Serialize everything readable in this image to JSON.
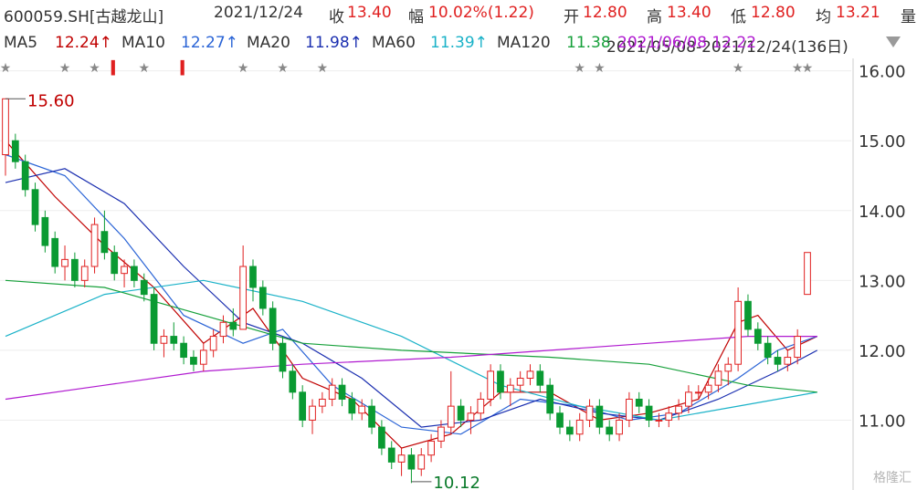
{
  "header": {
    "code": "600059.SH[古越龙山]",
    "date": "2021/12/24",
    "close_label": "收",
    "close_value": "13.40",
    "change_label": "幅",
    "change_value": "10.02%(1.22)",
    "open_label": "开",
    "open_value": "12.80",
    "high_label": "高",
    "high_value": "13.40",
    "low_label": "低",
    "low_value": "12.80",
    "avg_label": "均",
    "avg_value": "13.21",
    "volume_label": "量"
  },
  "ma_row": {
    "ma5_label": "MA5",
    "ma5_value": "12.24↑",
    "ma10_label": "MA10",
    "ma10_value": "12.27↑",
    "ma20_label": "MA20",
    "ma20_value": "11.98↑",
    "ma60_label": "MA60",
    "ma60_value": "11.39↑",
    "ma120_label": "MA120",
    "ma120_value": "11.38",
    "range_text": "2021/05/08-2021/12/24(136日)",
    "overlay_text": "2021/06/08 12.22",
    "dropdown_icon": "triangle-down-icon"
  },
  "annotations": {
    "high": "15.60",
    "low": "10.12"
  },
  "watermark": "格隆汇",
  "colors": {
    "up": "#e02020",
    "down": "#0a9a32",
    "ma5": "#c00000",
    "ma10": "#2a64d6",
    "ma20": "#1b2fb0",
    "ma60": "#1ab2c8",
    "ma120": "#16a03a",
    "ma250": "#b01ad0",
    "marker": "#888888"
  },
  "chart_data": {
    "type": "candlestick",
    "ylim": [
      10.0,
      16.1
    ],
    "yticks": [
      "16.00",
      "15.00",
      "14.00",
      "13.00",
      "12.00",
      "11.00"
    ],
    "candles": [
      [
        14.8,
        15.6,
        14.5,
        15.6
      ],
      [
        15.0,
        15.1,
        14.6,
        14.7
      ],
      [
        14.7,
        14.8,
        14.2,
        14.3
      ],
      [
        14.3,
        14.4,
        13.7,
        13.8
      ],
      [
        13.9,
        14.0,
        13.4,
        13.5
      ],
      [
        13.6,
        13.7,
        13.1,
        13.2
      ],
      [
        13.2,
        13.5,
        13.0,
        13.3
      ],
      [
        13.3,
        13.4,
        12.9,
        13.0
      ],
      [
        13.0,
        13.3,
        12.9,
        13.2
      ],
      [
        13.2,
        13.9,
        13.1,
        13.8
      ],
      [
        13.7,
        14.0,
        13.3,
        13.4
      ],
      [
        13.4,
        13.5,
        13.0,
        13.1
      ],
      [
        13.1,
        13.3,
        12.9,
        13.2
      ],
      [
        13.2,
        13.3,
        12.9,
        13.0
      ],
      [
        13.0,
        13.1,
        12.7,
        12.8
      ],
      [
        12.8,
        12.9,
        12.0,
        12.1
      ],
      [
        12.1,
        12.3,
        11.9,
        12.2
      ],
      [
        12.2,
        12.4,
        12.0,
        12.1
      ],
      [
        12.1,
        12.2,
        11.8,
        11.9
      ],
      [
        11.9,
        12.0,
        11.7,
        11.8
      ],
      [
        11.8,
        12.1,
        11.7,
        12.0
      ],
      [
        12.0,
        12.3,
        11.9,
        12.2
      ],
      [
        12.2,
        12.5,
        12.1,
        12.4
      ],
      [
        12.4,
        12.6,
        12.2,
        12.3
      ],
      [
        12.3,
        13.5,
        12.3,
        13.2
      ],
      [
        13.2,
        13.3,
        12.7,
        12.9
      ],
      [
        12.9,
        13.0,
        12.5,
        12.6
      ],
      [
        12.6,
        12.7,
        12.0,
        12.1
      ],
      [
        12.1,
        12.2,
        11.6,
        11.7
      ],
      [
        11.7,
        11.8,
        11.3,
        11.4
      ],
      [
        11.4,
        11.5,
        10.9,
        11.0
      ],
      [
        11.0,
        11.3,
        10.8,
        11.2
      ],
      [
        11.2,
        11.4,
        11.1,
        11.3
      ],
      [
        11.3,
        11.6,
        11.2,
        11.5
      ],
      [
        11.5,
        11.6,
        11.2,
        11.3
      ],
      [
        11.3,
        11.4,
        11.0,
        11.1
      ],
      [
        11.1,
        11.3,
        11.0,
        11.2
      ],
      [
        11.2,
        11.3,
        10.8,
        10.9
      ],
      [
        10.9,
        11.0,
        10.5,
        10.6
      ],
      [
        10.6,
        10.7,
        10.3,
        10.4
      ],
      [
        10.4,
        10.6,
        10.2,
        10.5
      ],
      [
        10.5,
        10.6,
        10.1,
        10.3
      ],
      [
        10.3,
        10.6,
        10.2,
        10.5
      ],
      [
        10.5,
        10.8,
        10.4,
        10.7
      ],
      [
        10.7,
        11.0,
        10.6,
        10.9
      ],
      [
        10.9,
        11.7,
        10.8,
        11.2
      ],
      [
        11.2,
        11.3,
        10.9,
        11.0
      ],
      [
        11.0,
        11.2,
        10.8,
        11.1
      ],
      [
        11.1,
        11.4,
        11.0,
        11.3
      ],
      [
        11.3,
        11.8,
        11.2,
        11.7
      ],
      [
        11.7,
        11.8,
        11.3,
        11.4
      ],
      [
        11.4,
        11.6,
        11.2,
        11.5
      ],
      [
        11.5,
        11.7,
        11.4,
        11.6
      ],
      [
        11.6,
        11.8,
        11.5,
        11.7
      ],
      [
        11.7,
        11.8,
        11.4,
        11.5
      ],
      [
        11.5,
        11.6,
        11.0,
        11.1
      ],
      [
        11.1,
        11.2,
        10.8,
        10.9
      ],
      [
        10.9,
        11.0,
        10.7,
        10.8
      ],
      [
        10.8,
        11.1,
        10.7,
        11.0
      ],
      [
        11.0,
        11.3,
        10.9,
        11.2
      ],
      [
        11.2,
        11.3,
        10.8,
        10.9
      ],
      [
        10.9,
        11.0,
        10.7,
        10.8
      ],
      [
        10.8,
        11.1,
        10.7,
        11.0
      ],
      [
        11.0,
        11.4,
        10.9,
        11.3
      ],
      [
        11.3,
        11.4,
        11.1,
        11.2
      ],
      [
        11.2,
        11.3,
        10.9,
        11.0
      ],
      [
        11.0,
        11.1,
        10.9,
        11.0
      ],
      [
        11.0,
        11.2,
        10.9,
        11.1
      ],
      [
        11.1,
        11.3,
        11.0,
        11.2
      ],
      [
        11.2,
        11.5,
        11.1,
        11.4
      ],
      [
        11.4,
        11.5,
        11.3,
        11.4
      ],
      [
        11.4,
        11.6,
        11.3,
        11.5
      ],
      [
        11.5,
        11.8,
        11.4,
        11.7
      ],
      [
        11.7,
        11.9,
        11.5,
        11.8
      ],
      [
        11.8,
        12.9,
        11.7,
        12.7
      ],
      [
        12.7,
        12.8,
        12.2,
        12.3
      ],
      [
        12.3,
        12.4,
        12.0,
        12.1
      ],
      [
        12.1,
        12.2,
        11.8,
        11.9
      ],
      [
        11.9,
        12.0,
        11.7,
        11.8
      ],
      [
        11.8,
        12.0,
        11.7,
        11.9
      ],
      [
        11.9,
        12.3,
        11.8,
        12.2
      ],
      [
        12.8,
        13.4,
        12.8,
        13.4
      ]
    ],
    "ma_series": [
      {
        "key": "ma5",
        "values": [
          [
            0,
            15.0
          ],
          [
            5,
            14.2
          ],
          [
            10,
            13.5
          ],
          [
            15,
            12.9
          ],
          [
            20,
            12.1
          ],
          [
            25,
            12.6
          ],
          [
            30,
            11.6
          ],
          [
            35,
            11.3
          ],
          [
            40,
            10.6
          ],
          [
            45,
            10.8
          ],
          [
            50,
            11.4
          ],
          [
            55,
            11.4
          ],
          [
            60,
            11.0
          ],
          [
            65,
            11.1
          ],
          [
            70,
            11.3
          ],
          [
            74,
            12.4
          ],
          [
            76,
            12.5
          ],
          [
            79,
            12.0
          ],
          [
            82,
            12.2
          ]
        ]
      },
      {
        "key": "ma10",
        "values": [
          [
            0,
            14.8
          ],
          [
            6,
            14.5
          ],
          [
            12,
            13.6
          ],
          [
            18,
            12.5
          ],
          [
            24,
            12.1
          ],
          [
            28,
            12.3
          ],
          [
            33,
            11.5
          ],
          [
            40,
            10.9
          ],
          [
            46,
            10.8
          ],
          [
            52,
            11.3
          ],
          [
            58,
            11.2
          ],
          [
            63,
            11.0
          ],
          [
            68,
            11.1
          ],
          [
            74,
            11.6
          ],
          [
            78,
            12.0
          ],
          [
            82,
            12.2
          ]
        ]
      },
      {
        "key": "ma20",
        "values": [
          [
            0,
            14.4
          ],
          [
            6,
            14.6
          ],
          [
            12,
            14.1
          ],
          [
            18,
            13.2
          ],
          [
            24,
            12.4
          ],
          [
            30,
            12.1
          ],
          [
            36,
            11.6
          ],
          [
            42,
            10.9
          ],
          [
            48,
            11.0
          ],
          [
            54,
            11.3
          ],
          [
            60,
            11.1
          ],
          [
            66,
            11.0
          ],
          [
            72,
            11.3
          ],
          [
            78,
            11.7
          ],
          [
            82,
            12.0
          ]
        ]
      },
      {
        "key": "ma60",
        "values": [
          [
            0,
            12.2
          ],
          [
            10,
            12.8
          ],
          [
            20,
            13.0
          ],
          [
            30,
            12.7
          ],
          [
            40,
            12.2
          ],
          [
            50,
            11.5
          ],
          [
            58,
            11.2
          ],
          [
            66,
            11.0
          ],
          [
            74,
            11.2
          ],
          [
            82,
            11.4
          ]
        ]
      },
      {
        "key": "ma120",
        "values": [
          [
            0,
            13.0
          ],
          [
            10,
            12.9
          ],
          [
            20,
            12.5
          ],
          [
            30,
            12.1
          ],
          [
            40,
            12.0
          ],
          [
            55,
            11.9
          ],
          [
            65,
            11.8
          ],
          [
            75,
            11.5
          ],
          [
            82,
            11.4
          ]
        ]
      },
      {
        "key": "ma250",
        "values": [
          [
            0,
            11.3
          ],
          [
            10,
            11.5
          ],
          [
            20,
            11.7
          ],
          [
            30,
            11.8
          ],
          [
            45,
            11.9
          ],
          [
            55,
            12.0
          ],
          [
            65,
            12.1
          ],
          [
            75,
            12.2
          ],
          [
            82,
            12.2
          ]
        ]
      }
    ],
    "markers": [
      0,
      6,
      9,
      11,
      14,
      18,
      24,
      28,
      32,
      58,
      60,
      74,
      80,
      81
    ],
    "marker_highlight": [
      3,
      5
    ]
  }
}
